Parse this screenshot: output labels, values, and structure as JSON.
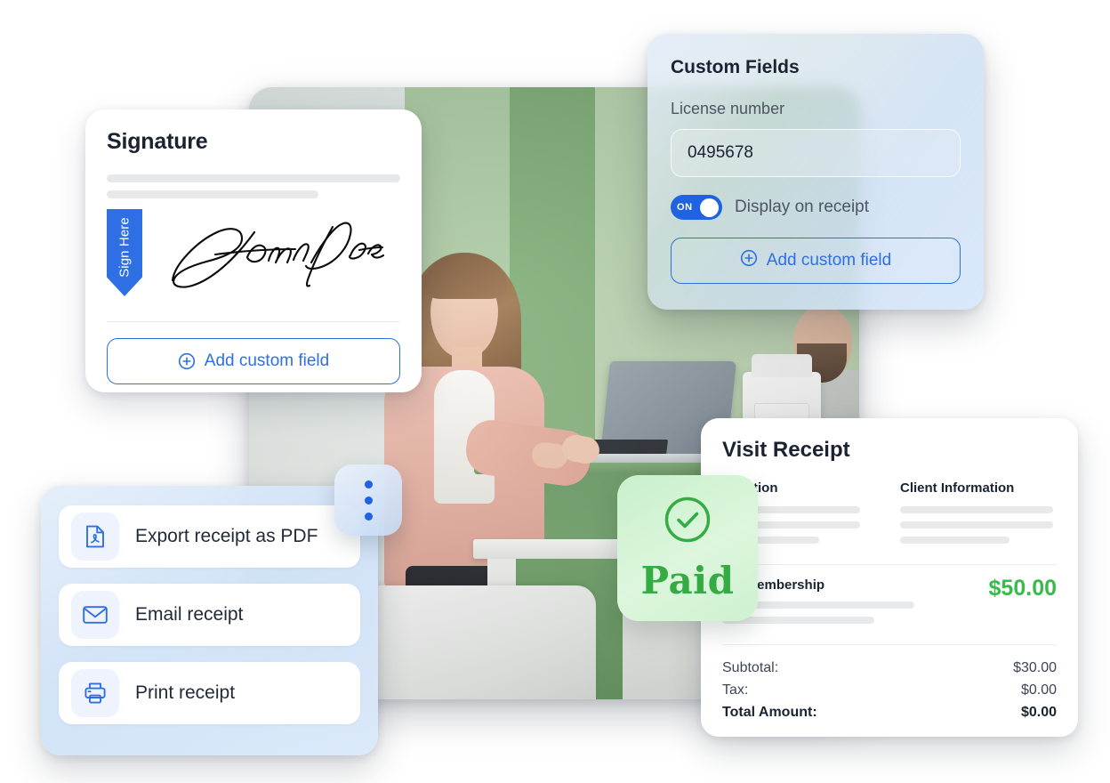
{
  "signature_card": {
    "title": "Signature",
    "sign_here_label": "Sign Here",
    "signature_name": "John Doe",
    "add_field_button": "Add custom field",
    "plus_icon": "plus-circle-icon"
  },
  "custom_fields_card": {
    "title": "Custom Fields",
    "field_label": "License number",
    "field_value": "0495678",
    "toggle_state": "ON",
    "toggle_label": "Display on receipt",
    "add_field_button": "Add custom field",
    "plus_icon": "plus-circle-icon"
  },
  "actions_card": {
    "items": [
      {
        "label": "Export receipt as PDF",
        "icon": "pdf-file-icon"
      },
      {
        "label": "Email receipt",
        "icon": "envelope-icon"
      },
      {
        "label": "Print receipt",
        "icon": "printer-icon"
      }
    ]
  },
  "dots_button": {
    "icon": "three-dots-vertical-icon"
  },
  "paid_badge": {
    "label": "Paid",
    "icon": "check-circle-icon",
    "color": "#35ab44",
    "background": "#cdf1d0"
  },
  "receipt_card": {
    "title": "Visit Receipt",
    "columns": [
      {
        "heading": "Location"
      },
      {
        "heading": "Client Information"
      }
    ],
    "line_item": {
      "name": "um Membership",
      "price": "$50.00"
    },
    "totals": [
      {
        "label": "Subtotal:",
        "value": "$30.00"
      },
      {
        "label": "Tax:",
        "value": "$0.00"
      },
      {
        "label": "Total Amount:",
        "value": "$0.00"
      }
    ]
  },
  "theme": {
    "accent_blue": "#2f6fe4",
    "toggle_blue": "#1f63e0",
    "green": "#39bb4b",
    "text_dark": "#1b2333"
  }
}
